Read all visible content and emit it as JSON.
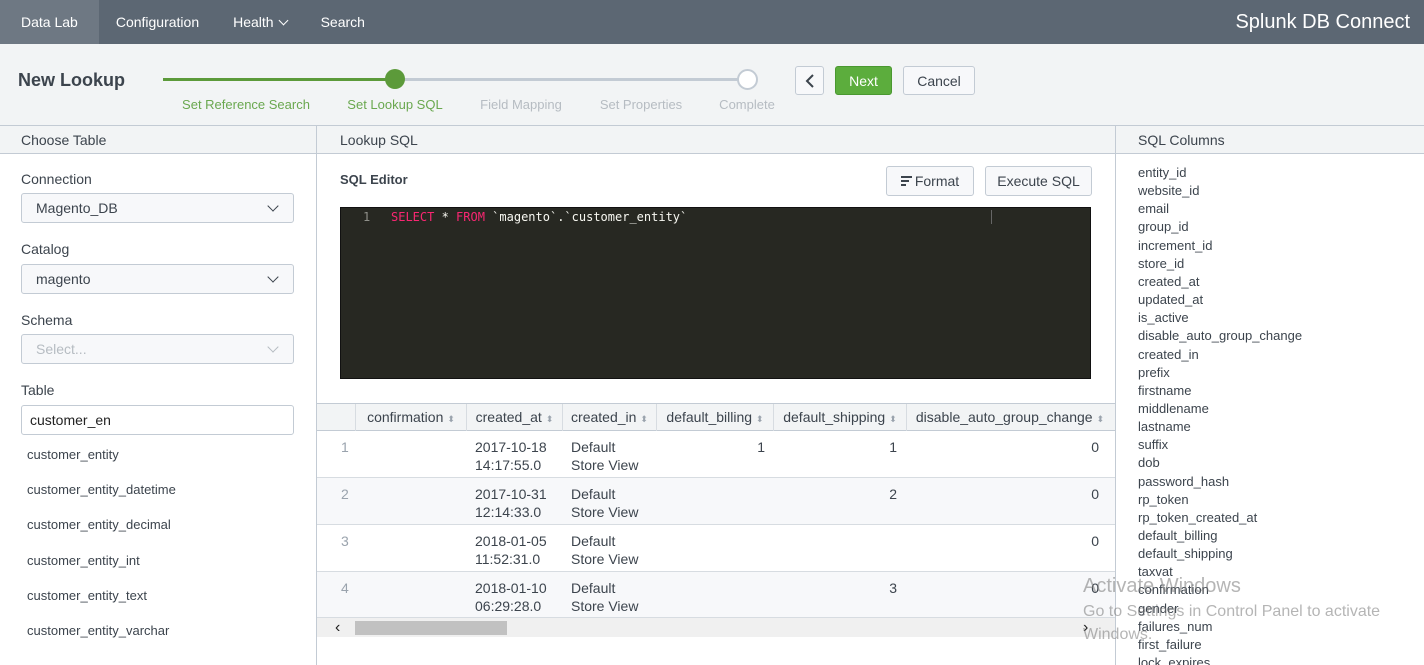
{
  "nav": {
    "items": [
      "Data Lab",
      "Configuration",
      "Health",
      "Search"
    ],
    "app_title": "Splunk DB Connect"
  },
  "header": {
    "title": "New Lookup",
    "steps": [
      "Set Reference Search",
      "Set Lookup SQL",
      "Field Mapping",
      "Set Properties",
      "Complete"
    ],
    "current_step": 2,
    "back_icon": "chevron-left-icon",
    "next_label": "Next",
    "cancel_label": "Cancel",
    "accent_color": "#5cad3d"
  },
  "left": {
    "heading": "Choose Table",
    "connection_label": "Connection",
    "connection_value": "Magento_DB",
    "catalog_label": "Catalog",
    "catalog_value": "magento",
    "schema_label": "Schema",
    "schema_placeholder": "Select...",
    "table_label": "Table",
    "table_value": "customer_en",
    "table_options": [
      "customer_entity",
      "customer_entity_datetime",
      "customer_entity_decimal",
      "customer_entity_int",
      "customer_entity_text",
      "customer_entity_varchar"
    ]
  },
  "middle": {
    "heading": "Lookup SQL",
    "editor_title": "SQL Editor",
    "format_label": "Format",
    "execute_label": "Execute SQL",
    "code": {
      "line_no": "1",
      "kw1": "SELECT",
      "star": " * ",
      "kw2": "FROM",
      "rest": " `magento`.`customer_entity`"
    },
    "columns": [
      "confirmation",
      "created_at",
      "created_in",
      "default_billing",
      "default_shipping",
      "disable_auto_group_change"
    ],
    "rows": [
      {
        "n": "1",
        "created_at": [
          "2017-10-18",
          "14:17:55.0"
        ],
        "created_in": [
          "Default",
          "Store View"
        ],
        "default_billing": "1",
        "default_shipping": "1",
        "disable": "0"
      },
      {
        "n": "2",
        "created_at": [
          "2017-10-31",
          "12:14:33.0"
        ],
        "created_in": [
          "Default",
          "Store View"
        ],
        "default_billing": "",
        "default_shipping": "2",
        "disable": "0"
      },
      {
        "n": "3",
        "created_at": [
          "2018-01-05",
          "11:52:31.0"
        ],
        "created_in": [
          "Default",
          "Store View"
        ],
        "default_billing": "",
        "default_shipping": "",
        "disable": "0"
      },
      {
        "n": "4",
        "created_at": [
          "2018-01-10",
          "06:29:28.0"
        ],
        "created_in": [
          "Default",
          "Store View"
        ],
        "default_billing": "",
        "default_shipping": "3",
        "disable": "0"
      }
    ]
  },
  "right": {
    "heading": "SQL Columns",
    "columns": [
      "entity_id",
      "website_id",
      "email",
      "group_id",
      "increment_id",
      "store_id",
      "created_at",
      "updated_at",
      "is_active",
      "disable_auto_group_change",
      "created_in",
      "prefix",
      "firstname",
      "middlename",
      "lastname",
      "suffix",
      "dob",
      "password_hash",
      "rp_token",
      "rp_token_created_at",
      "default_billing",
      "default_shipping",
      "taxvat",
      "confirmation",
      "gender",
      "failures_num",
      "first_failure",
      "lock_expires"
    ]
  },
  "watermark": {
    "line1": "Activate Windows",
    "line2": "Go to Settings in Control Panel to activate",
    "line3": "Windows."
  }
}
